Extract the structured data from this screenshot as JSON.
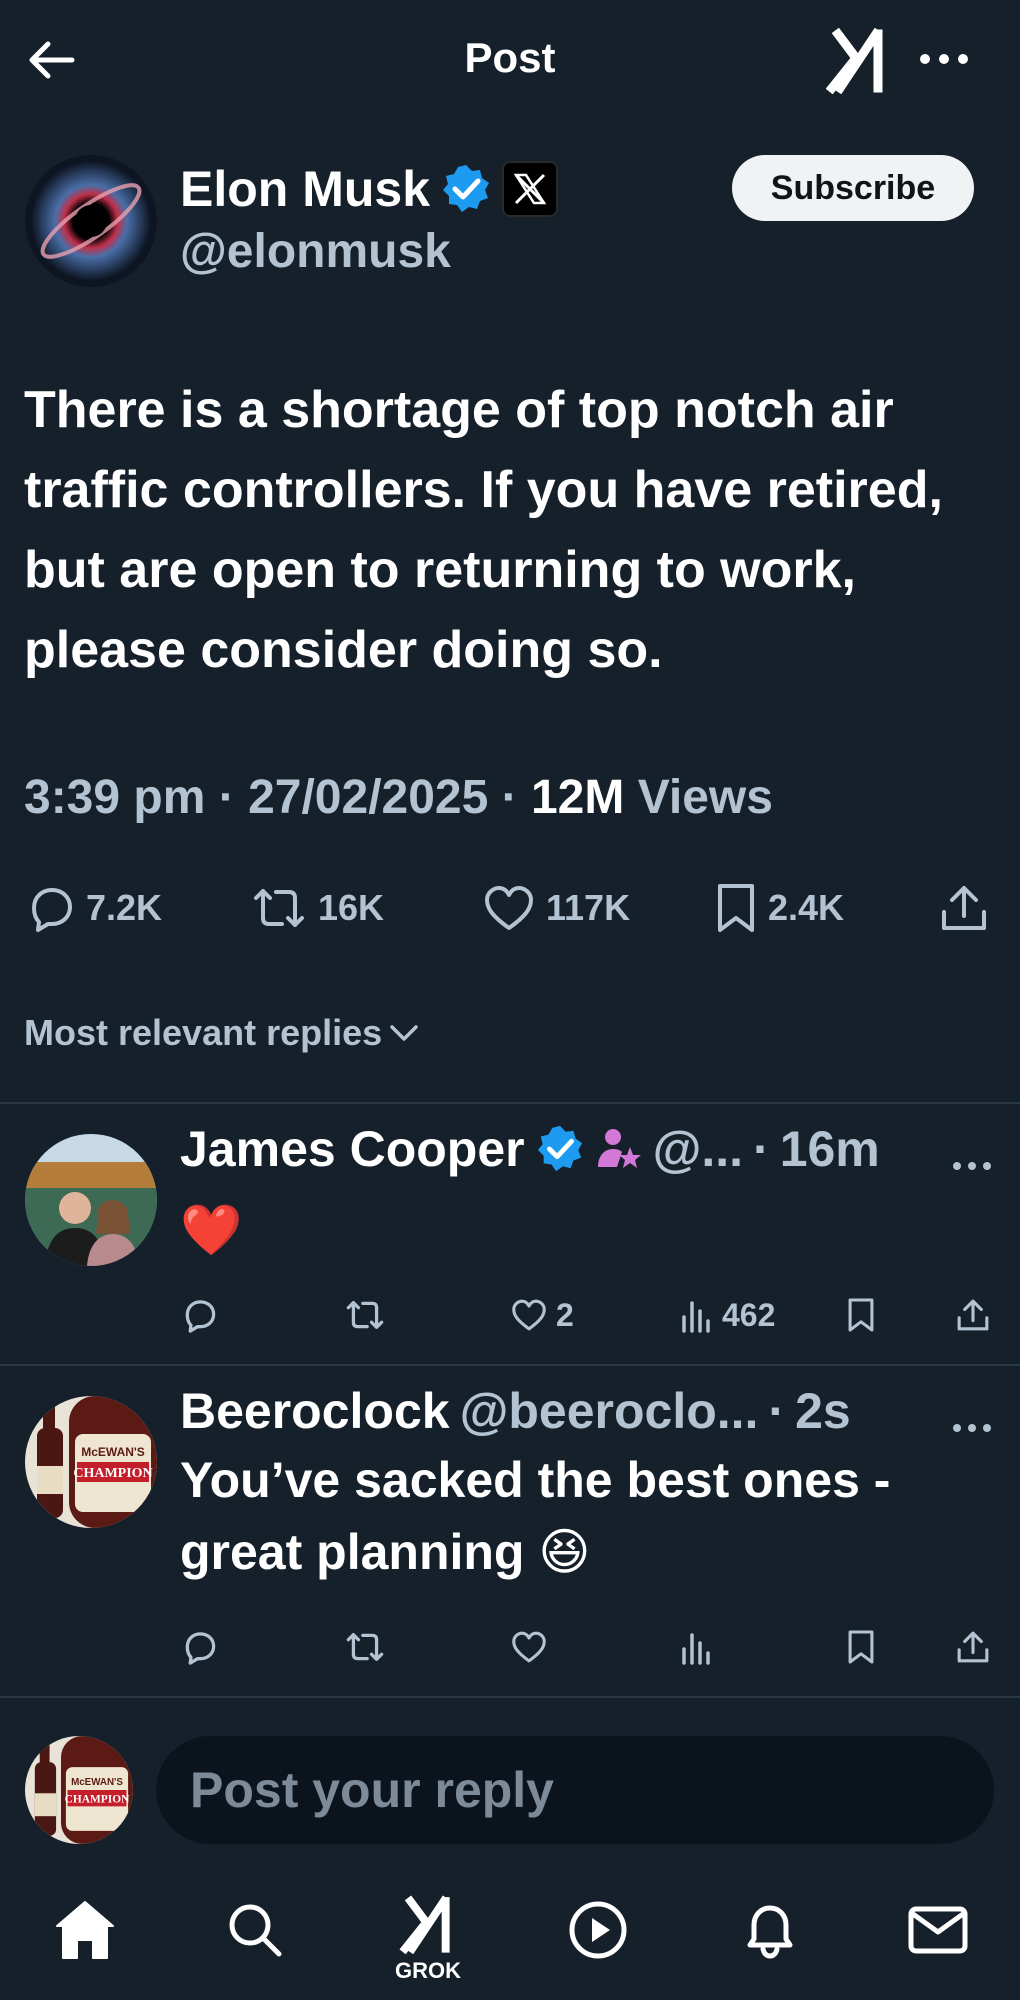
{
  "header": {
    "title": "Post",
    "back_icon": "arrow-left-icon",
    "grok_icon": "grok-icon",
    "more_icon": "more-horizontal-icon"
  },
  "author": {
    "name": "Elon Musk",
    "handle": "@elonmusk",
    "verified_icon": "verified-badge-icon",
    "affiliate_icon": "x-logo-icon",
    "subscribe_label": "Subscribe"
  },
  "post": {
    "text": "There is a shortage of top notch air traffic controllers. If you have retired, but are open to returning to work, please consider doing so.",
    "time": "3:39 pm",
    "date": "27/02/2025",
    "views_count": "12M",
    "views_label": "Views"
  },
  "actions": {
    "replies": "7.2K",
    "reposts": "16K",
    "likes": "117K",
    "bookmarks": "2.4K"
  },
  "sort_label": "Most relevant replies",
  "replies": [
    {
      "name": "James Cooper",
      "handle": "@...",
      "separator": "·",
      "time": "16m",
      "body": "❤️",
      "likes": "2",
      "views": "462"
    },
    {
      "name": "Beeroclock",
      "handle": "@beeroclo...",
      "separator": "·",
      "time": "2s",
      "body": "You’ve sacked the best ones  - great planning 😆",
      "likes": "",
      "views": ""
    }
  ],
  "composer": {
    "placeholder": "Post your reply"
  },
  "nav": {
    "grok_label": "GROK"
  },
  "avatar_labels": {
    "brand": "McEWAN'S",
    "product": "CHAMPION"
  },
  "colors": {
    "background": "#15202b",
    "secondary_text": "#b4c3d2",
    "verified": "#1d9bf0",
    "subscribe_bg": "#eff3f4"
  }
}
